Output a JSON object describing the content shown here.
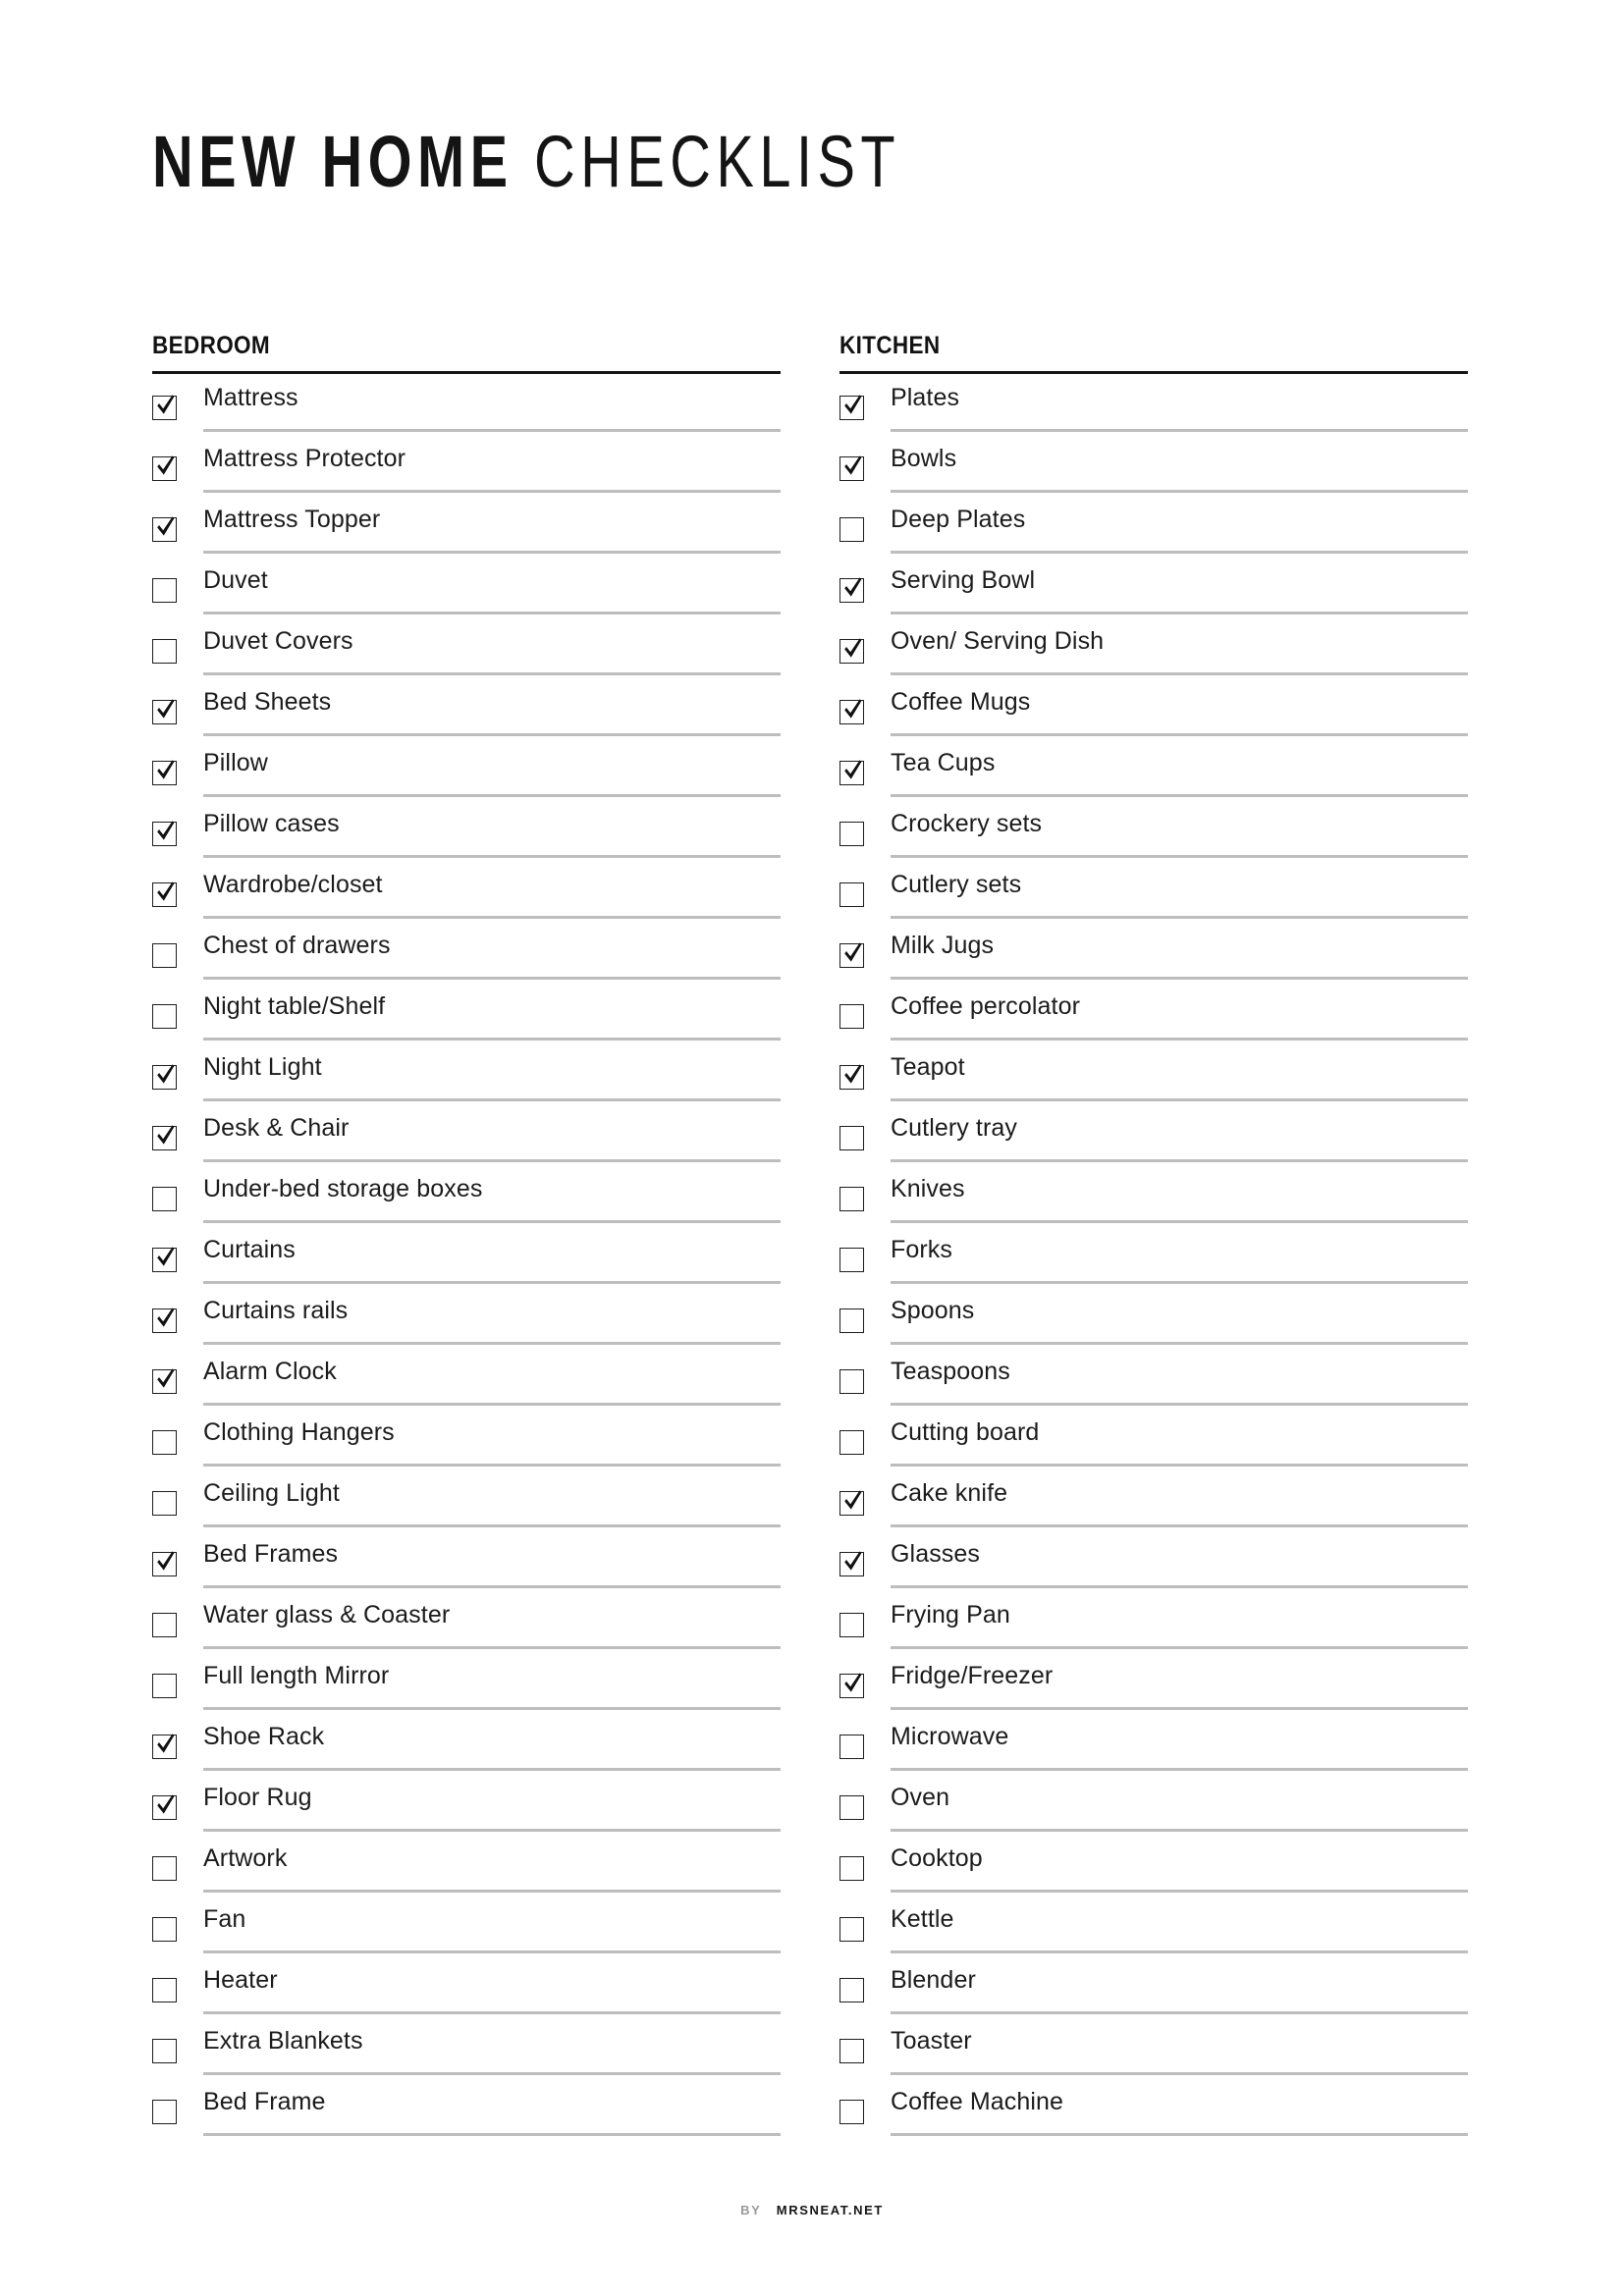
{
  "document": {
    "title_bold": "NEW HOME",
    "title_light": "CHECKLIST"
  },
  "footer": {
    "by_label": "BY",
    "brand": "MRSNEAT.NET"
  },
  "colors": {
    "text": "#1a1a1a",
    "header_rule": "#141414",
    "item_rule": "#bdbdbd",
    "checkbox_border": "#1d1d1d",
    "footer_by": "#9a9a9a",
    "footer_brand": "#161616",
    "page_background": "#ffffff"
  },
  "columns": [
    {
      "header": "BEDROOM",
      "items": [
        {
          "label": "Mattress",
          "checked": true
        },
        {
          "label": "Mattress Protector",
          "checked": true
        },
        {
          "label": "Mattress Topper",
          "checked": true
        },
        {
          "label": "Duvet",
          "checked": false
        },
        {
          "label": "Duvet Covers",
          "checked": false
        },
        {
          "label": "Bed Sheets",
          "checked": true
        },
        {
          "label": "Pillow",
          "checked": true
        },
        {
          "label": "Pillow cases",
          "checked": true
        },
        {
          "label": "Wardrobe/closet",
          "checked": true
        },
        {
          "label": "Chest of drawers",
          "checked": false
        },
        {
          "label": "Night table/Shelf",
          "checked": false
        },
        {
          "label": "Night Light",
          "checked": true
        },
        {
          "label": "Desk & Chair",
          "checked": true
        },
        {
          "label": "Under-bed storage boxes",
          "checked": false
        },
        {
          "label": "Curtains",
          "checked": true
        },
        {
          "label": "Curtains rails",
          "checked": true
        },
        {
          "label": "Alarm Clock",
          "checked": true
        },
        {
          "label": "Clothing Hangers",
          "checked": false
        },
        {
          "label": "Ceiling Light",
          "checked": false
        },
        {
          "label": "Bed Frames",
          "checked": true
        },
        {
          "label": "Water glass & Coaster",
          "checked": false
        },
        {
          "label": "Full length Mirror",
          "checked": false
        },
        {
          "label": "Shoe Rack",
          "checked": true
        },
        {
          "label": "Floor Rug",
          "checked": true
        },
        {
          "label": "Artwork",
          "checked": false
        },
        {
          "label": "Fan",
          "checked": false
        },
        {
          "label": "Heater",
          "checked": false
        },
        {
          "label": "Extra Blankets",
          "checked": false
        },
        {
          "label": "Bed Frame",
          "checked": false
        }
      ]
    },
    {
      "header": "KITCHEN",
      "items": [
        {
          "label": "Plates",
          "checked": true
        },
        {
          "label": "Bowls",
          "checked": true
        },
        {
          "label": "Deep Plates",
          "checked": false
        },
        {
          "label": "Serving Bowl",
          "checked": true
        },
        {
          "label": "Oven/ Serving Dish",
          "checked": true
        },
        {
          "label": "Coffee Mugs",
          "checked": true
        },
        {
          "label": "Tea Cups",
          "checked": true
        },
        {
          "label": "Crockery sets",
          "checked": false
        },
        {
          "label": "Cutlery sets",
          "checked": false
        },
        {
          "label": "Milk Jugs",
          "checked": true
        },
        {
          "label": "Coffee percolator",
          "checked": false
        },
        {
          "label": "Teapot",
          "checked": true
        },
        {
          "label": "Cutlery tray",
          "checked": false
        },
        {
          "label": "Knives",
          "checked": false
        },
        {
          "label": "Forks",
          "checked": false
        },
        {
          "label": "Spoons",
          "checked": false
        },
        {
          "label": "Teaspoons",
          "checked": false
        },
        {
          "label": "Cutting board",
          "checked": false
        },
        {
          "label": "Cake knife",
          "checked": true
        },
        {
          "label": "Glasses",
          "checked": true
        },
        {
          "label": "Frying Pan",
          "checked": false
        },
        {
          "label": "Fridge/Freezer",
          "checked": true
        },
        {
          "label": "Microwave",
          "checked": false
        },
        {
          "label": "Oven",
          "checked": false
        },
        {
          "label": "Cooktop",
          "checked": false
        },
        {
          "label": "Kettle",
          "checked": false
        },
        {
          "label": "Blender",
          "checked": false
        },
        {
          "label": "Toaster",
          "checked": false
        },
        {
          "label": "Coffee Machine",
          "checked": false
        }
      ]
    }
  ]
}
